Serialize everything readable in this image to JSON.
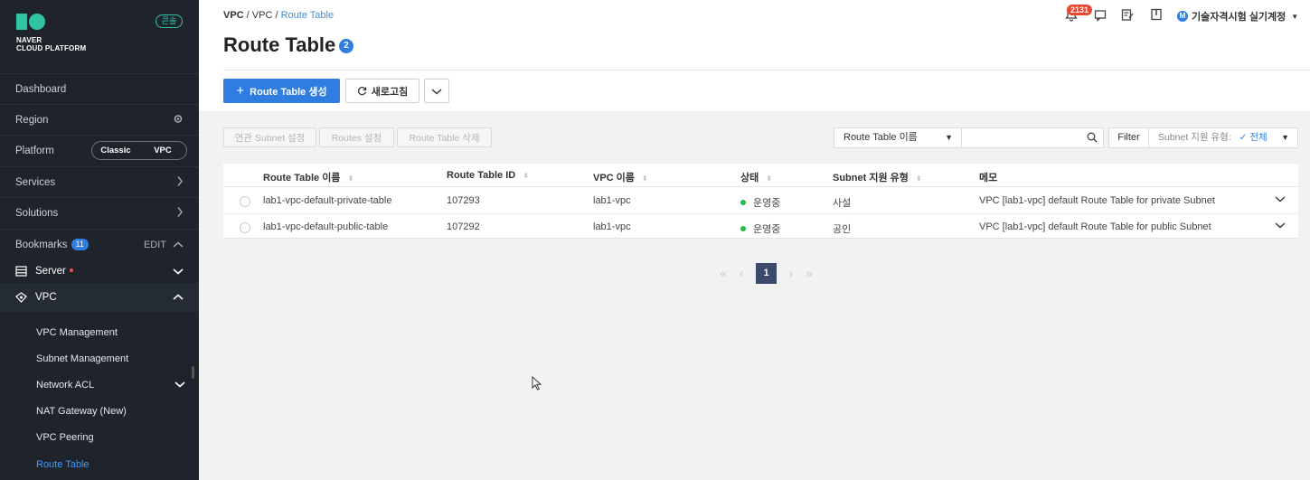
{
  "sidebar": {
    "logo": {
      "line1": "NAVER",
      "line2": "CLOUD PLATFORM"
    },
    "console_badge": "콘솔",
    "items": [
      {
        "label": "Dashboard"
      },
      {
        "label": "Region"
      },
      {
        "label": "Platform"
      },
      {
        "label": "Services"
      },
      {
        "label": "Solutions"
      }
    ],
    "platform_toggle": {
      "classic": "Classic",
      "vpc": "VPC"
    },
    "bookmarks": {
      "label": "Bookmarks",
      "count": "11",
      "edit": "EDIT"
    },
    "bookmark_items": [
      {
        "label": "Server"
      },
      {
        "label": "VPC"
      }
    ],
    "vpc_sub_items": [
      {
        "label": "VPC Management"
      },
      {
        "label": "Subnet Management"
      },
      {
        "label": "Network ACL"
      },
      {
        "label": "NAT Gateway (New)"
      },
      {
        "label": "VPC Peering"
      },
      {
        "label": "Route Table"
      }
    ]
  },
  "breadcrumb": {
    "part1": "VPC",
    "sep": " / ",
    "part2": "VPC",
    "current": "Route Table"
  },
  "header": {
    "title": "Route Table",
    "count": "2",
    "notification_count": "2131",
    "account_initial": "M",
    "account_name": "기술자격시험 실기계정"
  },
  "actions": {
    "create": "Route Table 생성",
    "refresh": "새로고침"
  },
  "toolbar": {
    "subnet_setting": "연관 Subnet 설정",
    "routes_setting": "Routes 설정",
    "delete": "Route Table 삭제",
    "search_field": "Route Table 이름",
    "search_value": "",
    "filter": "Filter",
    "subnet_type_label": "Subnet 지원 유형:",
    "subnet_type_value": "전체"
  },
  "table": {
    "headers": {
      "name": "Route Table 이름",
      "id": "Route Table ID",
      "vpc": "VPC 이름",
      "status": "상태",
      "subnet_type": "Subnet 지원 유형",
      "memo": "메모"
    },
    "rows": [
      {
        "name": "lab1-vpc-default-private-table",
        "id": "107293",
        "vpc": "lab1-vpc",
        "status": "운영중",
        "subnet_type": "사설",
        "memo": "VPC [lab1-vpc] default Route Table for private Subnet"
      },
      {
        "name": "lab1-vpc-default-public-table",
        "id": "107292",
        "vpc": "lab1-vpc",
        "status": "운영중",
        "subnet_type": "공인",
        "memo": "VPC [lab1-vpc] default Route Table for public Subnet"
      }
    ]
  },
  "pagination": {
    "current": "1"
  },
  "colors": {
    "primary": "#2f7de1",
    "sidebar_bg": "#1f242c",
    "brand": "#2ec4a4",
    "status_ok": "#27b84a",
    "alert": "#e8482f"
  }
}
